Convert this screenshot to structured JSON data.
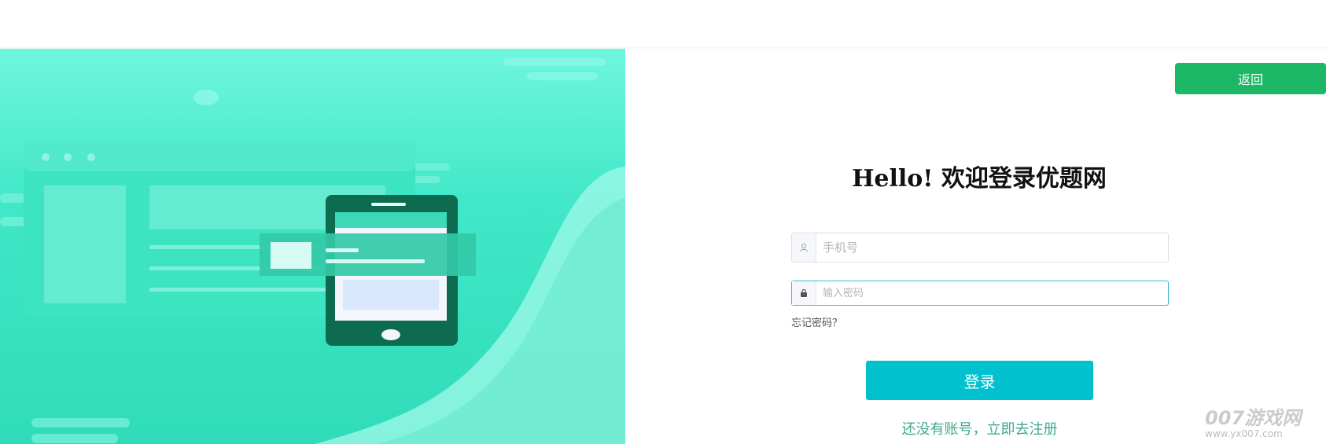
{
  "header": {
    "back_label": "返回"
  },
  "login": {
    "title": "Hello! 欢迎登录优题网",
    "phone_placeholder": "手机号",
    "password_placeholder": "输入密码",
    "forgot_label": "忘记密码？",
    "submit_label": "登录",
    "register_label": "还没有账号，立即去注册"
  },
  "icons": {
    "phone_field": "user-icon",
    "password_field": "lock-icon"
  },
  "colors": {
    "back_button": "#1db865",
    "login_button": "#00c1cd",
    "register_link": "#3fa991",
    "illustration": "#40e7c8"
  },
  "watermark": {
    "brand": "007游戏网",
    "url": "www.yx007.com"
  }
}
